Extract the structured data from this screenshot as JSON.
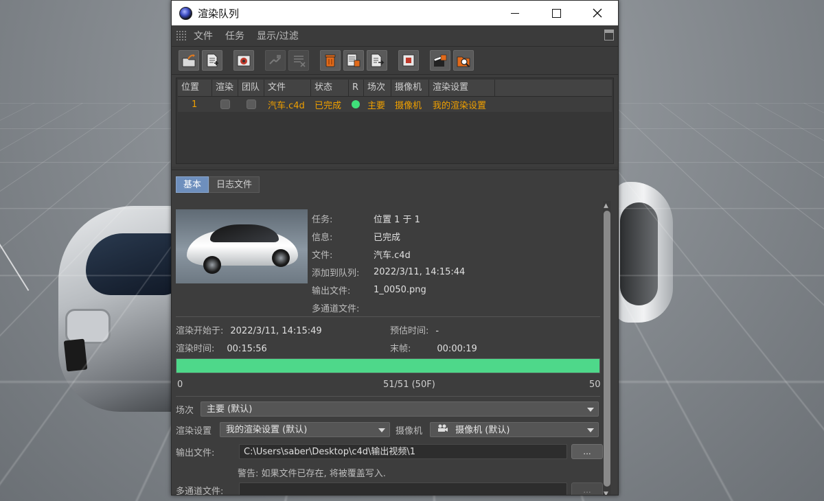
{
  "window": {
    "title": "渲染队列"
  },
  "menu": {
    "items": [
      "文件",
      "任务",
      "显示/过滤"
    ]
  },
  "toolbar": {
    "icons": [
      "open-folder-icon",
      "add-document-icon",
      "render-icon",
      "link-icon",
      "link-disabled-icon",
      "delete-icon",
      "delete-all-icon",
      "export-icon",
      "stop-render-icon",
      "film-render-icon",
      "search-folder-icon"
    ]
  },
  "queue": {
    "columns": [
      "位置",
      "渲染",
      "团队",
      "文件",
      "状态",
      "R",
      "场次",
      "摄像机",
      "渲染设置"
    ],
    "rows": [
      {
        "position": "1",
        "file": "汽车.c4d",
        "status": "已完成",
        "take": "主要",
        "camera": "摄像机",
        "render_setting": "我的渲染设置"
      }
    ]
  },
  "tabs": {
    "basic": "基本",
    "log": "日志文件"
  },
  "info": {
    "task_k": "任务:",
    "task_v": "位置 1 于 1",
    "msg_k": "信息:",
    "msg_v": "已完成",
    "file_k": "文件:",
    "file_v": "汽车.c4d",
    "added_k": "添加到队列:",
    "added_v": "2022/3/11, 14:15:44",
    "output_k": "输出文件:",
    "output_v": "1_0050.png",
    "multipass_k": "多通道文件:",
    "multipass_v": ""
  },
  "stats": {
    "start_k": "渲染开始于:",
    "start_v": "2022/3/11, 14:15:49",
    "eta_k": "预估时间:",
    "eta_v": "-",
    "time_k": "渲染时间:",
    "time_v": "00:15:56",
    "last_k": "末帧:",
    "last_v": "00:00:19"
  },
  "progress": {
    "value": 1.0,
    "min_label": "0",
    "center_label": "51/51 (50F)",
    "max_label": "50",
    "color": "#4ed88a"
  },
  "form": {
    "take_label": "场次",
    "take_value": "主要 (默认)",
    "render_setting_label": "渲染设置",
    "render_setting_value": "我的渲染设置 (默认)",
    "camera_label": "摄像机",
    "camera_value": "摄像机 (默认)",
    "output_label": "输出文件:",
    "output_path": "C:\\Users\\saber\\Desktop\\c4d\\输出视频\\1",
    "browse": "...",
    "warning": "警告: 如果文件已存在, 将被覆盖写入.",
    "multipass_label": "多通道文件:",
    "multipass_path": "",
    "browse2": "..."
  },
  "colors": {
    "accent_orange": "#f0a000",
    "status_green": "#3fe07a",
    "tab_active": "#6e8fbd"
  }
}
